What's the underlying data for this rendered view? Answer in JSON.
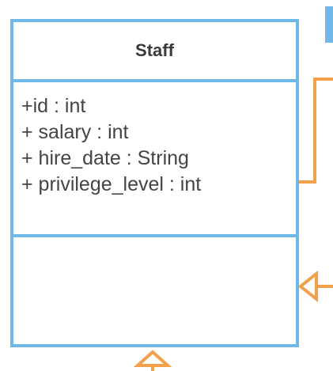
{
  "class": {
    "name": "Staff",
    "attributes": [
      "+id : int",
      "+ salary : int",
      "+ hire_date : String",
      "+ privilege_level : int"
    ],
    "operations": []
  },
  "colors": {
    "class_border": "#6fb8e8",
    "connector": "#f2a04a",
    "text": "#444444"
  }
}
